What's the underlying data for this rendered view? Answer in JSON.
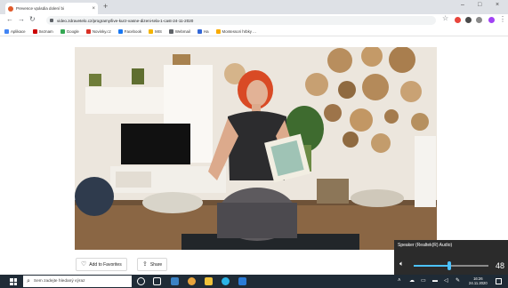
{
  "browser": {
    "tab_title": "Prevence vpásdia dolení bi",
    "tab_close": "×",
    "new_tab": "+",
    "url": "video.zdravetelo.cz/programy/live-kurz-vasne-dizeni-tela-1-cast-24-11-2020",
    "window_controls": {
      "minimize": "–",
      "maximize": "□",
      "close": "×"
    }
  },
  "bookmarks": [
    {
      "label": "Aplikace",
      "color": "#4285f4"
    },
    {
      "label": "Seznam",
      "color": "#cc0000"
    },
    {
      "label": "Google",
      "color": "#34a853"
    },
    {
      "label": "Novinky.cz",
      "color": "#d93025"
    },
    {
      "label": "Facebook",
      "color": "#1877f2"
    },
    {
      "label": "MIS",
      "color": "#f4b400"
    },
    {
      "label": "Webmail",
      "color": "#5f6368"
    },
    {
      "label": "Ha",
      "color": "#3367d6"
    },
    {
      "label": "Montessori hrbky ...",
      "color": "#f9ab00"
    }
  ],
  "actions": {
    "favorites_label": "Add to Favorites",
    "share_label": "Share"
  },
  "volume": {
    "device": "Speaker (Realtek(R) Audio)",
    "level": 48,
    "level_fraction": 0.48,
    "accent": "#4cc2ff"
  },
  "taskbar": {
    "search_placeholder": "Sem zadejte hledaný výraz",
    "time": "16:26",
    "date": "24.11.2020"
  }
}
